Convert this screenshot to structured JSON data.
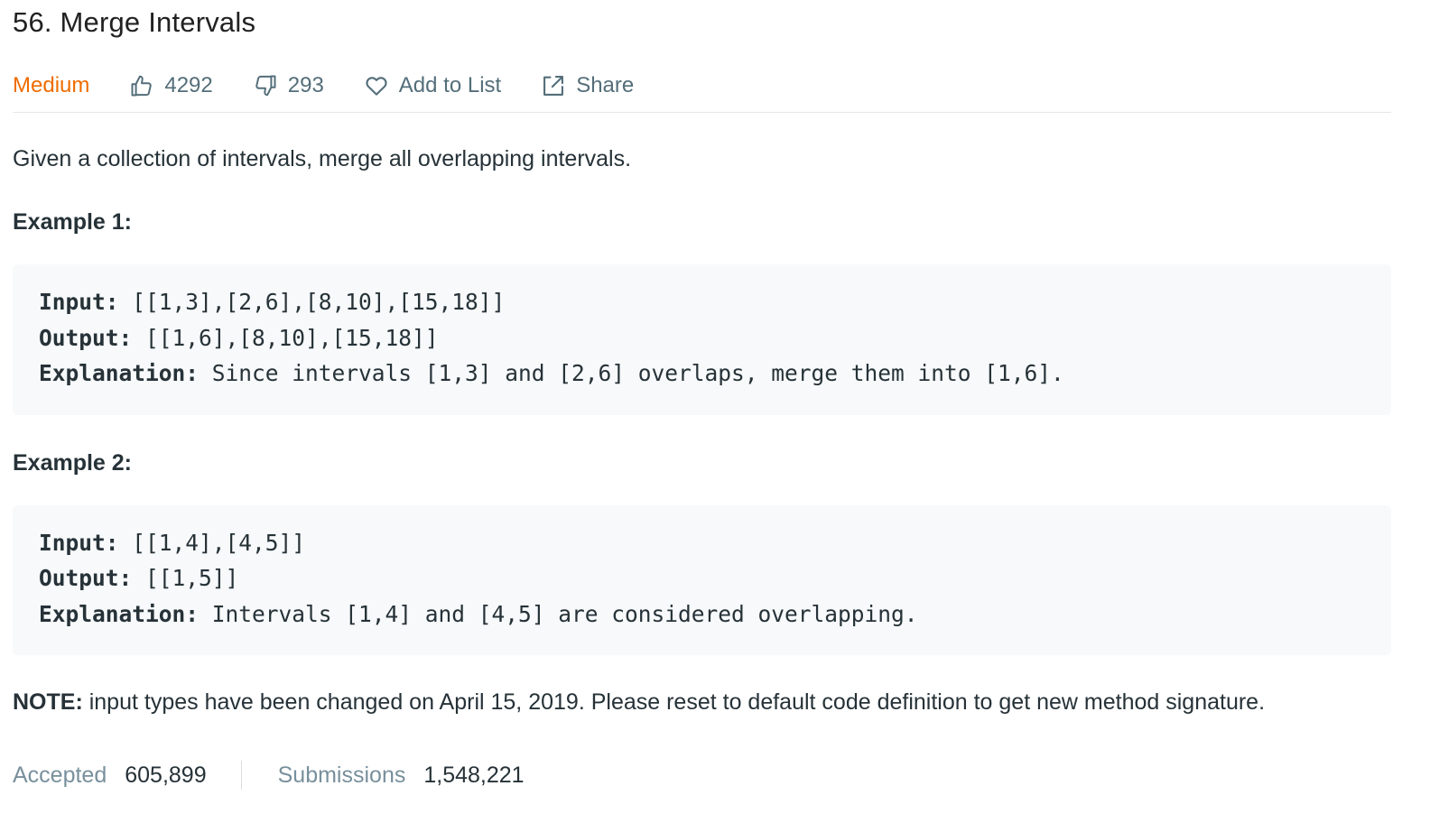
{
  "problem": {
    "title": "56. Merge Intervals",
    "difficulty": "Medium",
    "likes": "4292",
    "dislikes": "293",
    "add_to_list": "Add to List",
    "share": "Share"
  },
  "description": "Given a collection of intervals, merge all overlapping intervals.",
  "examples": [
    {
      "heading": "Example 1:",
      "input_label": "Input:",
      "input": " [[1,3],[2,6],[8,10],[15,18]]",
      "output_label": "Output:",
      "output": " [[1,6],[8,10],[15,18]]",
      "explanation_label": "Explanation:",
      "explanation": " Since intervals [1,3] and [2,6] overlaps, merge them into [1,6]."
    },
    {
      "heading": "Example 2:",
      "input_label": "Input:",
      "input": " [[1,4],[4,5]]",
      "output_label": "Output:",
      "output": " [[1,5]]",
      "explanation_label": "Explanation:",
      "explanation": " Intervals [1,4] and [4,5] are considered overlapping."
    }
  ],
  "note": {
    "label": "NOTE:",
    "text": " input types have been changed on April 15, 2019. Please reset to default code definition to get new method signature."
  },
  "stats": {
    "accepted_label": "Accepted",
    "accepted_value": "605,899",
    "submissions_label": "Submissions",
    "submissions_value": "1,548,221"
  },
  "colors": {
    "difficulty_medium": "#ef6c00",
    "meta_text": "#546e7a",
    "code_bg": "#f7f9fa"
  },
  "icons": {
    "like": "thumbs-up-icon",
    "dislike": "thumbs-down-icon",
    "add_to_list": "heart-icon",
    "share": "share-icon"
  }
}
